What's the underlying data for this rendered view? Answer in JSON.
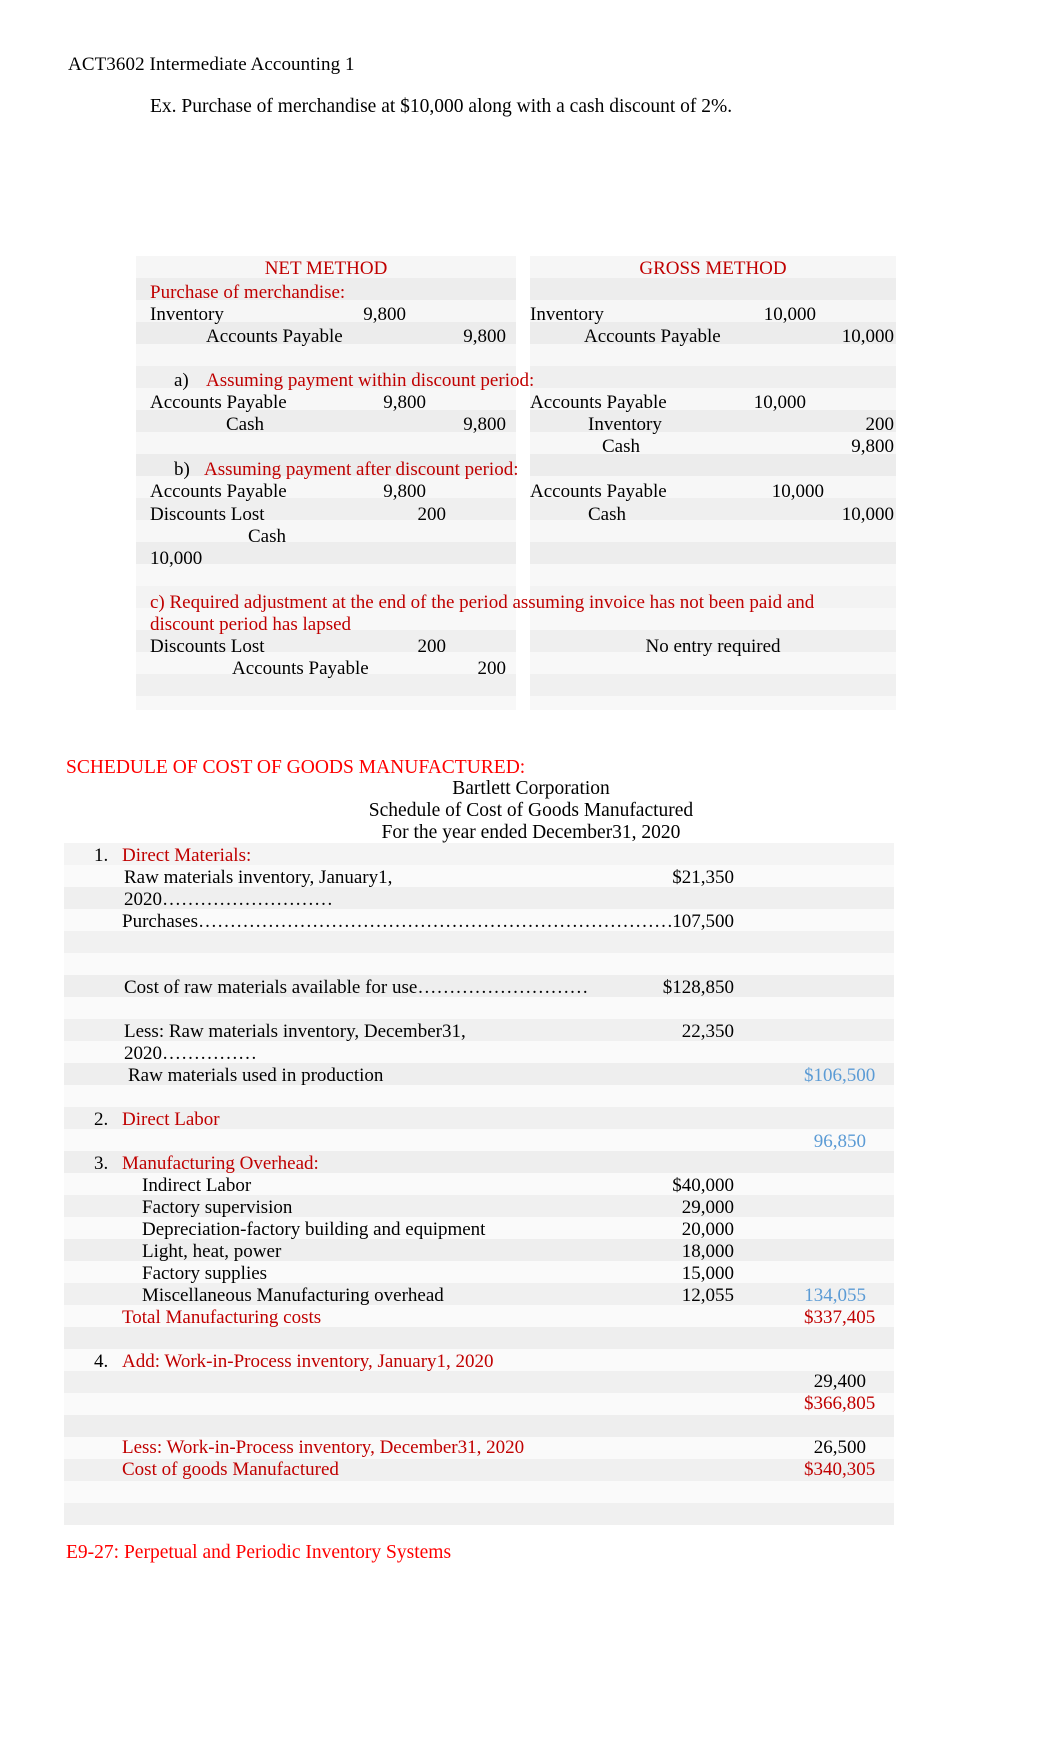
{
  "colors": {
    "accent_red": "#c00000",
    "bright_red": "#ff0000",
    "accent_blue": "#5b9bd5",
    "table_band_light": "#f8f8f8",
    "table_band_dark": "#ececec"
  },
  "document": {
    "course_header": "ACT3602 Intermediate Accounting 1",
    "example_line": "Ex. Purchase of merchandise at $10,000 along with a cash discount of 2%."
  },
  "methods_table": {
    "headers": {
      "net": "NET METHOD",
      "gross": "GROSS METHOD"
    },
    "section_purchase_label": "Purchase of merchandise:",
    "purchase": {
      "net": [
        {
          "account": "Inventory",
          "debit": "9,800",
          "credit": ""
        },
        {
          "account": "Accounts Payable",
          "debit": "",
          "credit": "9,800"
        }
      ],
      "gross": [
        {
          "account": "Inventory",
          "debit": "10,000",
          "credit": ""
        },
        {
          "account": "Accounts Payable",
          "debit": "",
          "credit": "10,000"
        }
      ]
    },
    "section_a_label": "a)",
    "section_a_text": "Assuming payment within discount period:",
    "within": {
      "net": [
        {
          "account": "Accounts Payable",
          "debit": "9,800",
          "credit": ""
        },
        {
          "account": "Cash",
          "debit": "",
          "credit": "9,800"
        }
      ],
      "gross": [
        {
          "account": "Accounts Payable",
          "debit": "10,000",
          "credit": ""
        },
        {
          "account": "Inventory",
          "debit": "",
          "credit": "200"
        },
        {
          "account": "Cash",
          "debit": "",
          "credit": "9,800"
        }
      ]
    },
    "section_b_label": "b)",
    "section_b_text": "Assuming payment after discount period:",
    "after": {
      "net": [
        {
          "account": "Accounts Payable",
          "debit": "9,800",
          "credit": ""
        },
        {
          "account": "Discounts Lost",
          "debit": "200",
          "credit": ""
        },
        {
          "account": "Cash",
          "debit": "",
          "credit": "10,000"
        }
      ],
      "gross": [
        {
          "account": "Accounts Payable",
          "debit": "10,000",
          "credit": ""
        },
        {
          "account": "Cash",
          "debit": "",
          "credit": "10,000"
        }
      ]
    },
    "section_c_text": "c) Required adjustment at the end of the period assuming invoice has not been paid and discount period has lapsed",
    "adjustment": {
      "net": [
        {
          "account": "Discounts Lost",
          "debit": "200",
          "credit": ""
        },
        {
          "account": "Accounts Payable",
          "debit": "",
          "credit": "200"
        }
      ],
      "gross_note": "No entry required"
    }
  },
  "schedule": {
    "section_title": "SCHEDULE OF COST OF GOODS MANUFACTURED:",
    "company": "Bartlett Corporation",
    "statement": "Schedule of Cost of Goods Manufactured",
    "period": "For the year ended December31, 2020",
    "items": {
      "num1": "1.",
      "direct_materials": "Direct Materials:",
      "raw_begin_label": "Raw materials inventory, January1, 2020………………………",
      "raw_begin_value": "$21,350",
      "purchases_label": "Purchases…………………………………………………………………",
      "purchases_value": "107,500",
      "available_label": "Cost of raw materials available for use………………………",
      "available_value": "$128,850",
      "raw_end_label": "Less: Raw materials inventory, December31, 2020……………",
      "raw_end_value": "22,350",
      "raw_used_label": "Raw materials used in production",
      "raw_used_value": "$106,500",
      "num2": "2.",
      "direct_labor": "Direct Labor",
      "direct_labor_value": "96,850",
      "num3": "3.",
      "manufacturing_overhead": "Manufacturing Overhead:",
      "overhead_rows": [
        {
          "label": "Indirect Labor",
          "value": "$40,000"
        },
        {
          "label": "Factory supervision",
          "value": "29,000"
        },
        {
          "label": "Depreciation-factory building and equipment",
          "value": "20,000"
        },
        {
          "label": "Light, heat, power",
          "value": "18,000"
        },
        {
          "label": "Factory supplies",
          "value": "15,000"
        },
        {
          "label": "Miscellaneous Manufacturing overhead",
          "value": "12,055"
        }
      ],
      "overhead_total": "134,055",
      "total_mfg_label": "Total Manufacturing costs",
      "total_mfg_value": "$337,405",
      "num4": "4.",
      "add_wip_label": "Add: Work-in-Process inventory, January1, 2020",
      "add_wip_value": "29,400",
      "subtotal_value": "$366,805",
      "less_wip_label": "Less: Work-in-Process inventory, December31, 2020",
      "less_wip_value": "26,500",
      "cogm_label": "Cost of goods Manufactured",
      "cogm_value": "$340,305"
    }
  },
  "footer": {
    "next_section": "E9-27: Perpetual and Periodic Inventory Systems"
  }
}
